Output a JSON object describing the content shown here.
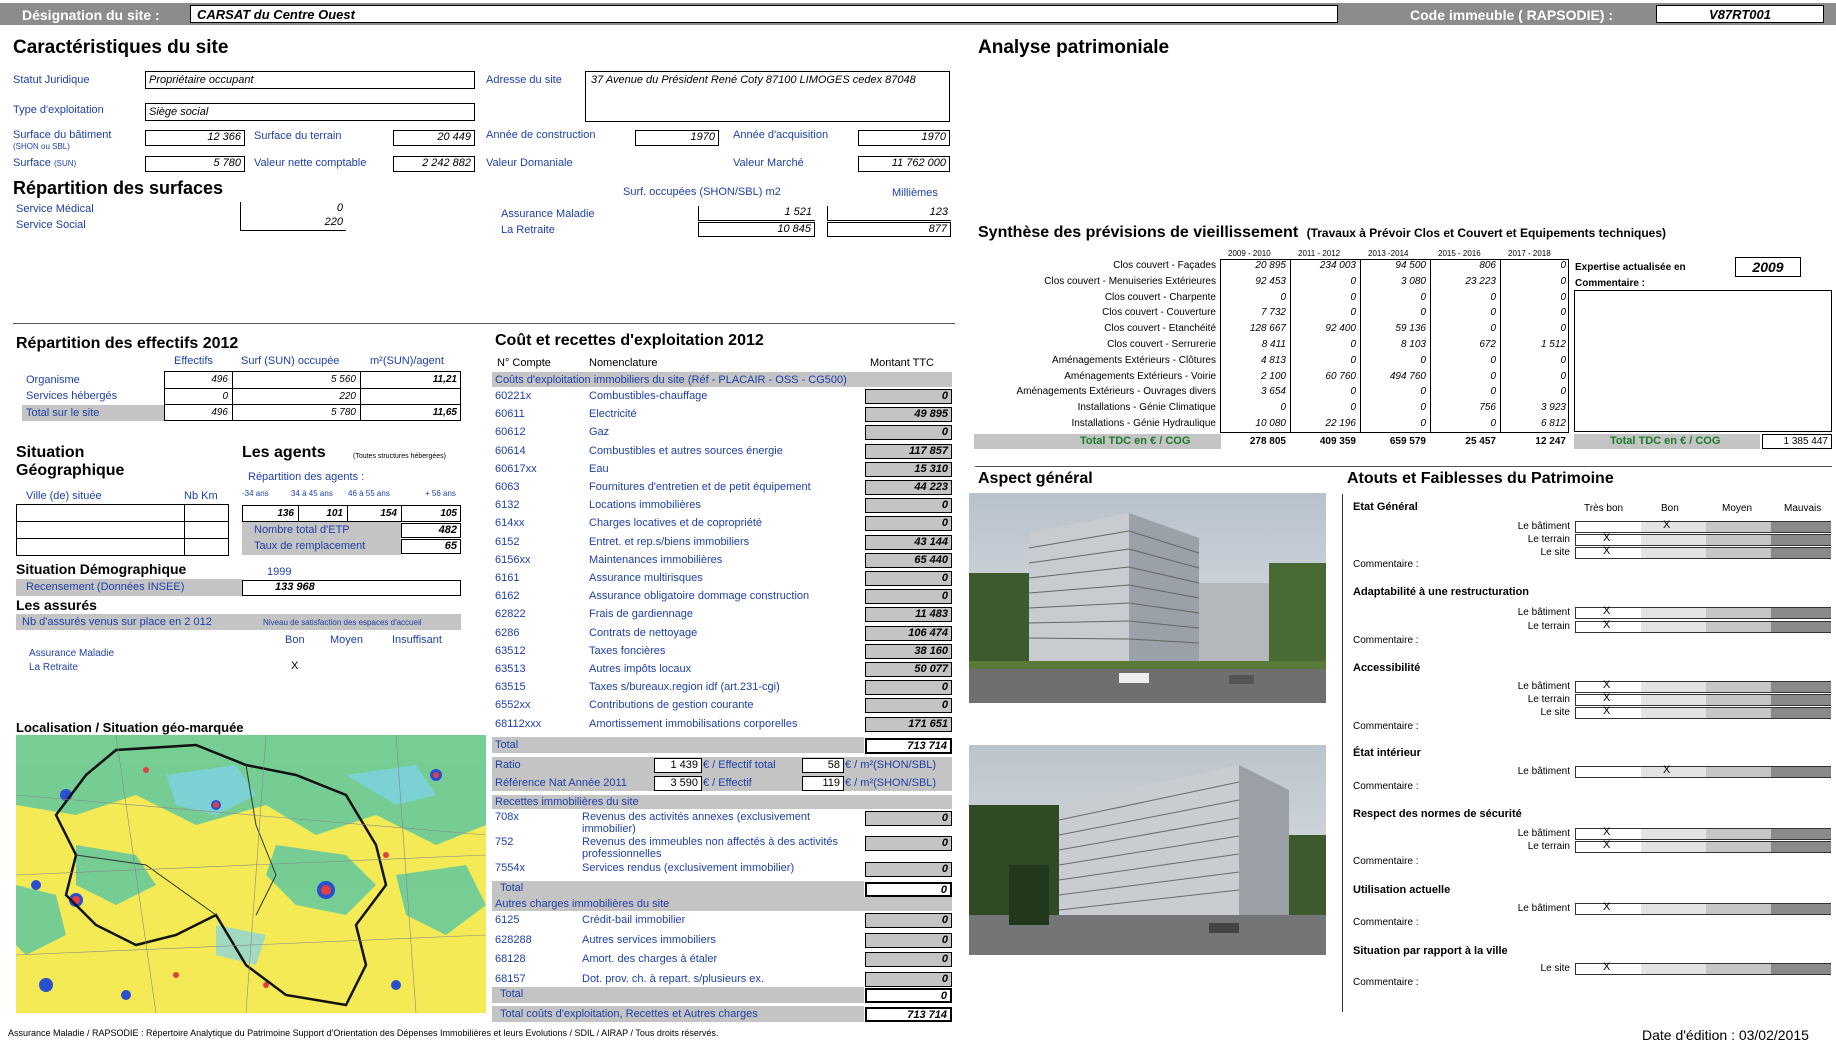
{
  "header": {
    "site_label": "Désignation du site :",
    "site_name": "CARSAT  du Centre Ouest",
    "code_label": "Code immeuble ( RAPSODIE) :",
    "code_value": "V87RT001"
  },
  "caracteristiques": {
    "title": "Caractéristiques du site",
    "statut_label": "Statut Juridique",
    "statut_value": "Propriétaire occupant",
    "exploitation_label": "Type d'exploitation",
    "exploitation_value": "Siège social",
    "adresse_label": "Adresse du site",
    "adresse_value": "37  Avenue du Président  René Coty   87100 LIMOGES cedex 87048",
    "surf_bat_label": "Surface du bâtiment",
    "surf_bat_sub": "(SHON ou SBL)",
    "surf_bat_value": "12 366",
    "surf_terrain_label": "Surface du terrain",
    "surf_terrain_value": "20 449",
    "annee_constr_label": "Année de construction",
    "annee_constr_value": "1970",
    "annee_acq_label": "Année d'acquisition",
    "annee_acq_value": "1970",
    "surface_sun_label": "Surface",
    "surface_sun_sub": "(SUN)",
    "surface_sun_value": "5 780",
    "vnc_label": "Valeur nette comptable",
    "vnc_value": "2 242 882",
    "domaniale_label": "Valeur Domaniale",
    "marche_label": "Valeur Marché",
    "marche_value": "11 762 000"
  },
  "surfaces": {
    "title": "Répartition des surfaces",
    "medical_label": "Service Médical",
    "medical_value": "0",
    "social_label": "Service Social",
    "social_value": "220",
    "col1": "Surf. occupées (SHON/SBL) m2",
    "col2": "Millièmes",
    "rows": [
      {
        "label": "Assurance Maladie",
        "surf": "1 521",
        "mil": "123"
      },
      {
        "label": "La Retraite",
        "surf": "10 845",
        "mil": "877"
      }
    ]
  },
  "analyse_title": "Analyse patrimoniale",
  "effectifs": {
    "title": "Répartition des effectifs 2012",
    "cols": [
      "Effectifs",
      "Surf (SUN) occupée",
      "m²(SUN)/agent"
    ],
    "rows": [
      {
        "label": "Organisme",
        "e": "496",
        "s": "5 560",
        "m": "11,21"
      },
      {
        "label": "Services hébergés",
        "e": "0",
        "s": "220",
        "m": ""
      },
      {
        "label": "Total sur le site",
        "e": "496",
        "s": "5 780",
        "m": "11,65"
      }
    ]
  },
  "situation": {
    "title1": "Situation",
    "title2": "Géographique",
    "ville_label": "Ville (de) située",
    "nbkm_label": "Nb Km",
    "agents_title": "Les agents",
    "agents_note": "(Toutes structures hébergées)",
    "repart_label": "Répartition des agents :",
    "ages": [
      "-34 ans",
      "34 à 45 ans",
      "46 à 55 ans",
      "+ 56 ans"
    ],
    "age_values": [
      "136",
      "101",
      "154",
      "105"
    ],
    "etp_label": "Nombre total d'ETP",
    "etp_value": "482",
    "remplacement_label": "Taux de remplacement",
    "remplacement_value": "65",
    "demo_title": "Situation Démographique",
    "demo_year": "1999",
    "recensement_label": "Recensement (Données INSEE)",
    "recensement_value": "133 968",
    "assures_title": "Les assurés",
    "assures_label": "Nb d'assurés venus sur place en 2 012",
    "satisfaction_label": "Niveau de satisfaction des espaces d'accueil",
    "sat_cols": [
      "Bon",
      "Moyen",
      "Insuffisant"
    ],
    "sat_rows": [
      {
        "label": "Assurance Maladie",
        "mark": ""
      },
      {
        "label": "La Retraite",
        "mark": "X"
      }
    ]
  },
  "localisation_title": "Localisation / Situation géo-marquée",
  "couts": {
    "title": "Coût et recettes d'exploitation 2012",
    "col_compte": "N° Compte",
    "col_nomen": "Nomenclature",
    "col_montant": "Montant TTC",
    "section1": "Coûts d'exploitation immobiliers du site (Réf - PLACAIR - OSS - CG500)",
    "rows": [
      {
        "c": "60221x",
        "n": "Combustibles-chauffage",
        "v": "0"
      },
      {
        "c": "60611",
        "n": "Electricité",
        "v": "49 895"
      },
      {
        "c": "60612",
        "n": "Gaz",
        "v": "0"
      },
      {
        "c": "60614",
        "n": "Combustibles et autres sources énergie",
        "v": "117 857"
      },
      {
        "c": "60617xx",
        "n": "Eau",
        "v": "15 310"
      },
      {
        "c": "6063",
        "n": "Fournitures d'entretien et de petit équipement",
        "v": "44 223"
      },
      {
        "c": "6132",
        "n": "Locations immobilières",
        "v": "0"
      },
      {
        "c": "614xx",
        "n": "Charges locatives et de copropriété",
        "v": "0"
      },
      {
        "c": "6152",
        "n": "Entret. et rep.s/biens immobiliers",
        "v": "43 144"
      },
      {
        "c": "6156xx",
        "n": "Maintenances immobilières",
        "v": "65 440"
      },
      {
        "c": "6161",
        "n": "Assurance multirisques",
        "v": "0"
      },
      {
        "c": "6162",
        "n": "Assurance obligatoire dommage construction",
        "v": "0"
      },
      {
        "c": "62822",
        "n": "Frais de gardiennage",
        "v": "11 483"
      },
      {
        "c": "6286",
        "n": "Contrats de nettoyage",
        "v": "106 474"
      },
      {
        "c": "63512",
        "n": "Taxes foncières",
        "v": "38 160"
      },
      {
        "c": "63513",
        "n": "Autres impôts locaux",
        "v": "50 077"
      },
      {
        "c": "63515",
        "n": "Taxes s/bureaux.region idf (art.231-cgi)",
        "v": "0"
      },
      {
        "c": "6552xx",
        "n": "Contributions de gestion courante",
        "v": "0"
      },
      {
        "c": "68112xxx",
        "n": "Amortissement immobilisations corporelles",
        "v": "171 651"
      }
    ],
    "total_label": "Total",
    "total_value": "713 714",
    "ratio_label": "Ratio",
    "ratio_v1": "1 439",
    "ratio_u1": "€ / Effectif total",
    "ratio_v2": "58",
    "ratio_u2": "€ / m²(SHON/SBL)",
    "ref_label": "Référence Nat Année 2011",
    "ref_v1": "3 590",
    "ref_u1": "€ / Effectif",
    "ref_v2": "119",
    "ref_u2": "€ / m²(SHON/SBL)",
    "section2": "Recettes immobilières du site",
    "recettes": [
      {
        "c": "708x",
        "n": "Revenus des activités annexes (exclusivement immobilier)",
        "v": "0"
      },
      {
        "c": "752",
        "n": "Revenus des immeubles non affectés à des activités professionnelles",
        "v": "0"
      },
      {
        "c": "7554x",
        "n": "Services rendus (exclusivement immobilier)",
        "v": "0"
      }
    ],
    "recettes_total_label": "Total",
    "recettes_total": "0",
    "section3": "Autres charges immobilières du site",
    "autres": [
      {
        "c": "6125",
        "n": "Crédit-bail immobilier",
        "v": "0"
      },
      {
        "c": "628288",
        "n": "Autres services immobiliers",
        "v": "0"
      },
      {
        "c": "68128",
        "n": "Amort. des charges à étaler",
        "v": "0"
      },
      {
        "c": "68157",
        "n": "Dot. prov. ch. à repart. s/plusieurs ex.",
        "v": "0"
      }
    ],
    "autres_total_label": "Total",
    "autres_total": "0",
    "grand_total_label": "Total coûts d'exploitation, Recettes et Autres charges",
    "grand_total": "713 714"
  },
  "synthese": {
    "title": "Synthèse des prévisions de vieillissement",
    "subtitle": "(Travaux à Prévoir Clos et Couvert et Equipements techniques)",
    "periods": [
      "2009 - 2010",
      "2011 - 2012",
      "2013 -2014",
      "2015 - 2016",
      "2017 - 2018"
    ],
    "rows": [
      {
        "label": "Clos couvert - Façades",
        "v": [
          "20 895",
          "234 003",
          "94 500",
          "806",
          "0"
        ]
      },
      {
        "label": "Clos couvert - Menuiseries Extérieures",
        "v": [
          "92 453",
          "0",
          "3 080",
          "23 223",
          "0"
        ]
      },
      {
        "label": "Clos couvert - Charpente",
        "v": [
          "0",
          "0",
          "0",
          "0",
          "0"
        ]
      },
      {
        "label": "Clos couvert - Couverture",
        "v": [
          "7 732",
          "0",
          "0",
          "0",
          "0"
        ]
      },
      {
        "label": "Clos couvert - Etanchéité",
        "v": [
          "128 667",
          "92 400",
          "59 136",
          "0",
          "0"
        ]
      },
      {
        "label": "Clos couvert - Serrurerie",
        "v": [
          "8 411",
          "0",
          "8 103",
          "672",
          "1 512"
        ]
      },
      {
        "label": "Aménagements Extérieurs - Clôtures",
        "v": [
          "4 813",
          "0",
          "0",
          "0",
          "0"
        ]
      },
      {
        "label": "Aménagements Extérieurs - Voirie",
        "v": [
          "2 100",
          "60 760",
          "494 760",
          "0",
          "0"
        ]
      },
      {
        "label": "Aménagements Extérieurs - Ouvrages divers",
        "v": [
          "3 654",
          "0",
          "0",
          "0",
          "0"
        ]
      },
      {
        "label": "Installations - Génie Climatique",
        "v": [
          "0",
          "0",
          "0",
          "756",
          "3 923"
        ]
      },
      {
        "label": "Installations - Génie Hydraulique",
        "v": [
          "10 080",
          "22 196",
          "0",
          "0",
          "6 812"
        ]
      }
    ],
    "total_label": "Total TDC en € / COG",
    "totals": [
      "278 805",
      "409 359",
      "659 579",
      "25 457",
      "12 247"
    ],
    "expertise_label": "Expertise actualisée en",
    "expertise_value": "2009",
    "commentaire_label": "Commentaire :",
    "total_label2": "Total TDC en € / COG",
    "grand_total": "1 385 447"
  },
  "aspect_title": "Aspect général",
  "atouts": {
    "title": "Atouts et Faiblesses du Patrimoine",
    "cols": [
      "Très bon",
      "Bon",
      "Moyen",
      "Mauvais"
    ],
    "comment": "Commentaire :",
    "sections": [
      {
        "title": "Etat Général",
        "items": [
          {
            "l": "Le bâtiment",
            "m": 1
          },
          {
            "l": "Le terrain",
            "m": 0
          },
          {
            "l": "Le site",
            "m": 0
          }
        ]
      },
      {
        "title": "Adaptabilité à une restructuration",
        "items": [
          {
            "l": "Le bâtiment",
            "m": 0
          },
          {
            "l": "Le terrain",
            "m": 0
          }
        ]
      },
      {
        "title": "Accessibilité",
        "items": [
          {
            "l": "Le bâtiment",
            "m": 0
          },
          {
            "l": "Le terrain",
            "m": 0
          },
          {
            "l": "Le site",
            "m": 0
          }
        ]
      },
      {
        "title": "État intérieur",
        "items": [
          {
            "l": "Le bâtiment",
            "m": 1
          }
        ]
      },
      {
        "title": "Respect des normes de sécurité",
        "items": [
          {
            "l": "Le bâtiment",
            "m": 0
          },
          {
            "l": "Le terrain",
            "m": 0
          }
        ]
      },
      {
        "title": "Utilisation actuelle",
        "items": [
          {
            "l": "Le bâtiment",
            "m": 0
          }
        ]
      },
      {
        "title": "Situation par rapport à la ville",
        "items": [
          {
            "l": "Le  site",
            "m": 0
          }
        ]
      }
    ],
    "mark": "X"
  },
  "footer": {
    "text": "Assurance Maladie / RAPSODIE : Répertoire Analytique du Patrimoine Support d'Orientation des Dépenses Immobilières et leurs Evolutions / SDIL / AIRAP / Tous droits réservés.",
    "date": "Date d'édition : 03/02/2015"
  },
  "colors": {
    "header_bg": "#8c8c8c",
    "blue": "#1f3fa8",
    "gray": "#c4c4c4"
  }
}
